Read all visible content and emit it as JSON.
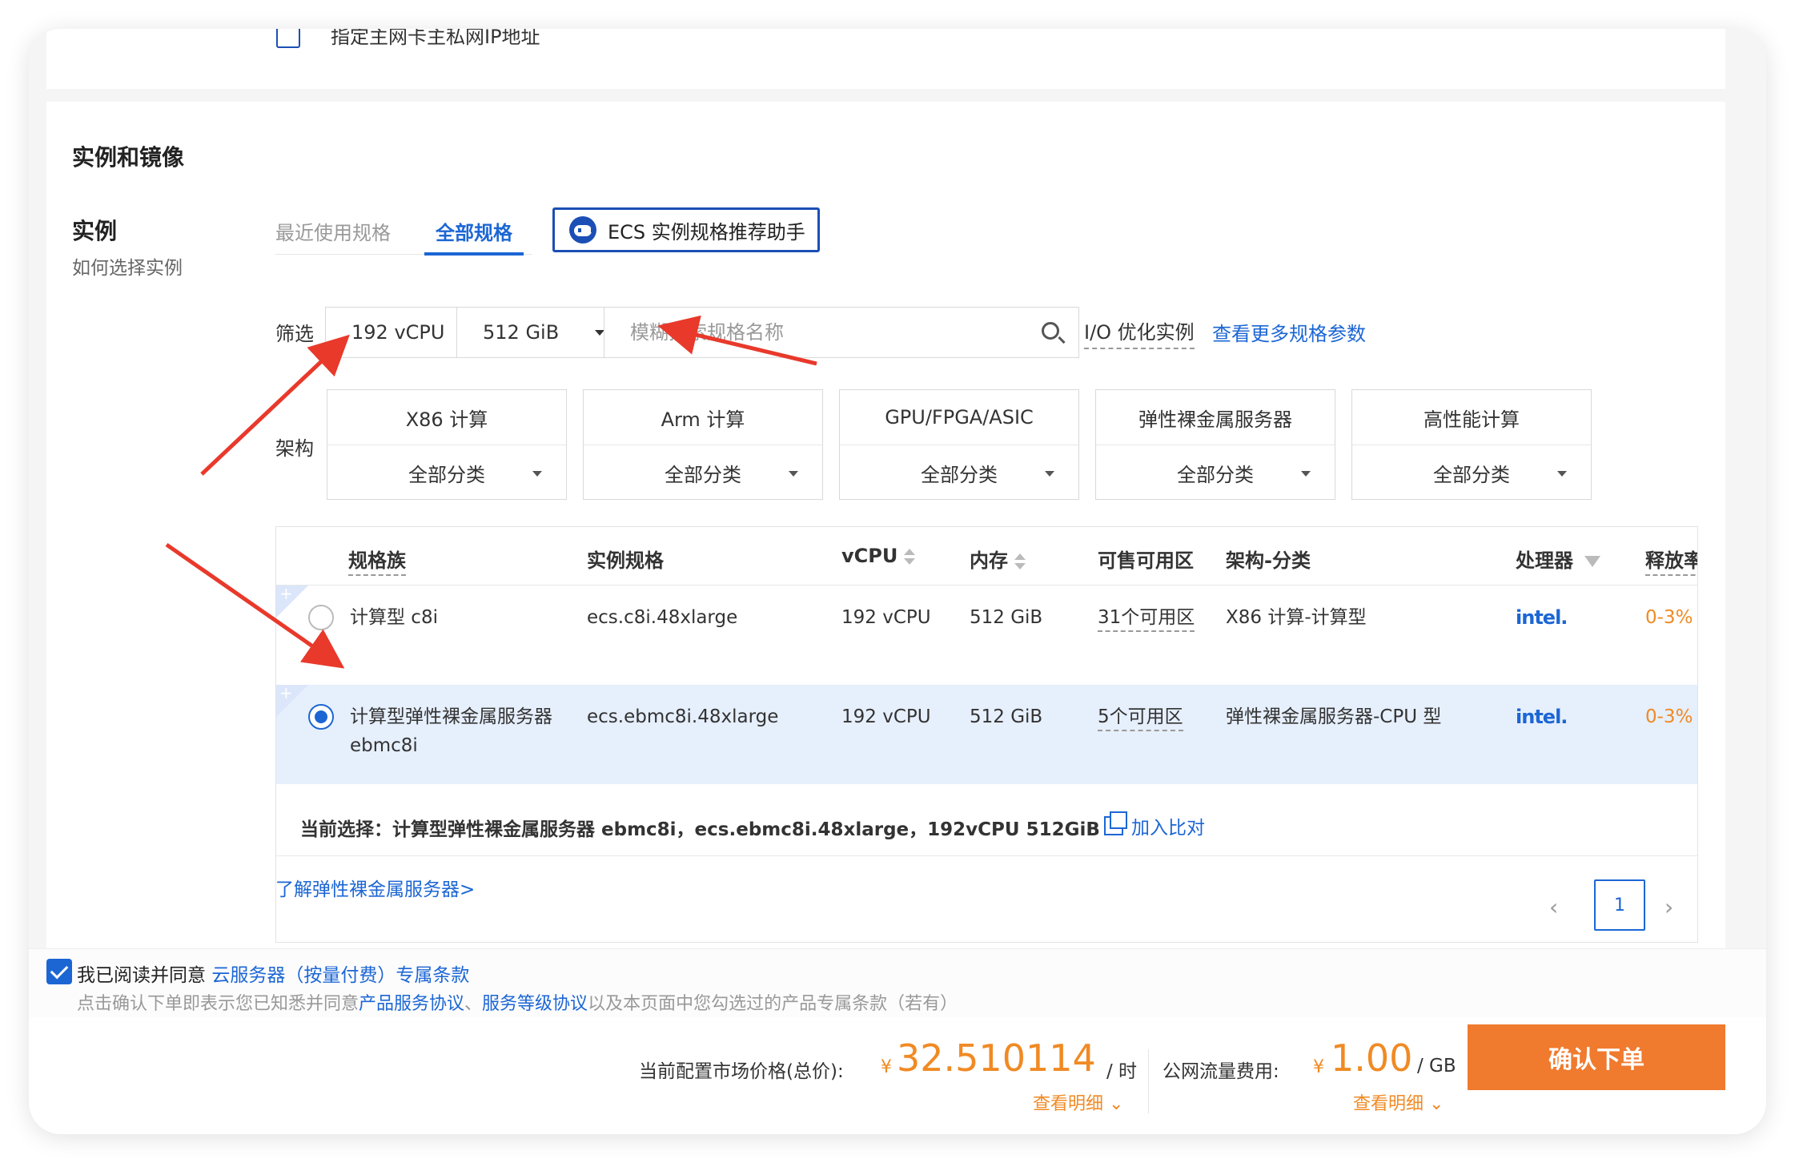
{
  "top_card": {
    "checkbox_label": "指定主网卡主私网IP地址"
  },
  "section": {
    "title": "实例和镜像"
  },
  "instance": {
    "title": "实例",
    "help": "如何选择实例",
    "tabs": [
      "最近使用规格",
      "全部规格"
    ],
    "assistant_label": "ECS 实例规格推荐助手"
  },
  "filter": {
    "label": "筛选",
    "vcpu": "192 vCPU",
    "memory": "512 GiB",
    "search_placeholder": "模糊搜索规格名称",
    "io_optimized": "I/O 优化实例",
    "more_link": "查看更多规格参数"
  },
  "arch": {
    "label": "架构",
    "columns": [
      {
        "name": "X86 计算",
        "select": "全部分类"
      },
      {
        "name": "Arm 计算",
        "select": "全部分类"
      },
      {
        "name": "GPU/FPGA/ASIC",
        "select": "全部分类"
      },
      {
        "name": "弹性裸金属服务器",
        "select": "全部分类"
      },
      {
        "name": "高性能计算",
        "select": "全部分类"
      }
    ]
  },
  "table": {
    "headers": {
      "family": "规格族",
      "spec": "实例规格",
      "vcpu": "vCPU",
      "memory": "内存",
      "zones": "可售可用区",
      "arch": "架构-分类",
      "cpu": "处理器",
      "release": "释放率"
    },
    "rows": [
      {
        "family": "计算型 c8i",
        "spec": "ecs.c8i.48xlarge",
        "vcpu": "192 vCPU",
        "memory": "512 GiB",
        "zones": "31个可用区",
        "arch": "X86 计算-计算型",
        "cpu": "intel.",
        "release": "0-3%",
        "selected": false
      },
      {
        "family": "计算型弹性裸金属服务器 ebmc8i",
        "spec": "ecs.ebmc8i.48xlarge",
        "vcpu": "192 vCPU",
        "memory": "512 GiB",
        "zones": "5个可用区",
        "arch": "弹性裸金属服务器-CPU 型",
        "cpu": "intel.",
        "release": "0-3%",
        "selected": true
      }
    ],
    "current_selection": "当前选择：计算型弹性裸金属服务器 ebmc8i，ecs.ebmc8i.48xlarge，192vCPU 512GiB",
    "compare_label": "加入比对",
    "page": "1"
  },
  "learn_link": "了解弹性裸金属服务器>",
  "agreement": {
    "prefix": "我已阅读并同意",
    "link": "云服务器（按量付费）专属条款",
    "notice_prefix": "点击确认下单即表示您已知悉并同意",
    "link_product": "产品服务协议",
    "sep": "、",
    "link_sla": "服务等级协议",
    "notice_suffix": "以及本页面中您勾选过的产品专属条款（若有）"
  },
  "price": {
    "label": "当前配置市场价格(总价):",
    "currency": "¥",
    "value": "32.510114",
    "unit": "/ 时",
    "detail": "查看明细",
    "traffic_label": "公网流量费用:",
    "traffic_value": "1.00",
    "traffic_unit": "/ GB",
    "traffic_detail": "查看明细"
  },
  "confirm_button": "确认下单",
  "colors": {
    "accent": "#1c66d4",
    "orange": "#f08a24",
    "confirm": "#f07a2e",
    "annotation": "#e8392b"
  }
}
